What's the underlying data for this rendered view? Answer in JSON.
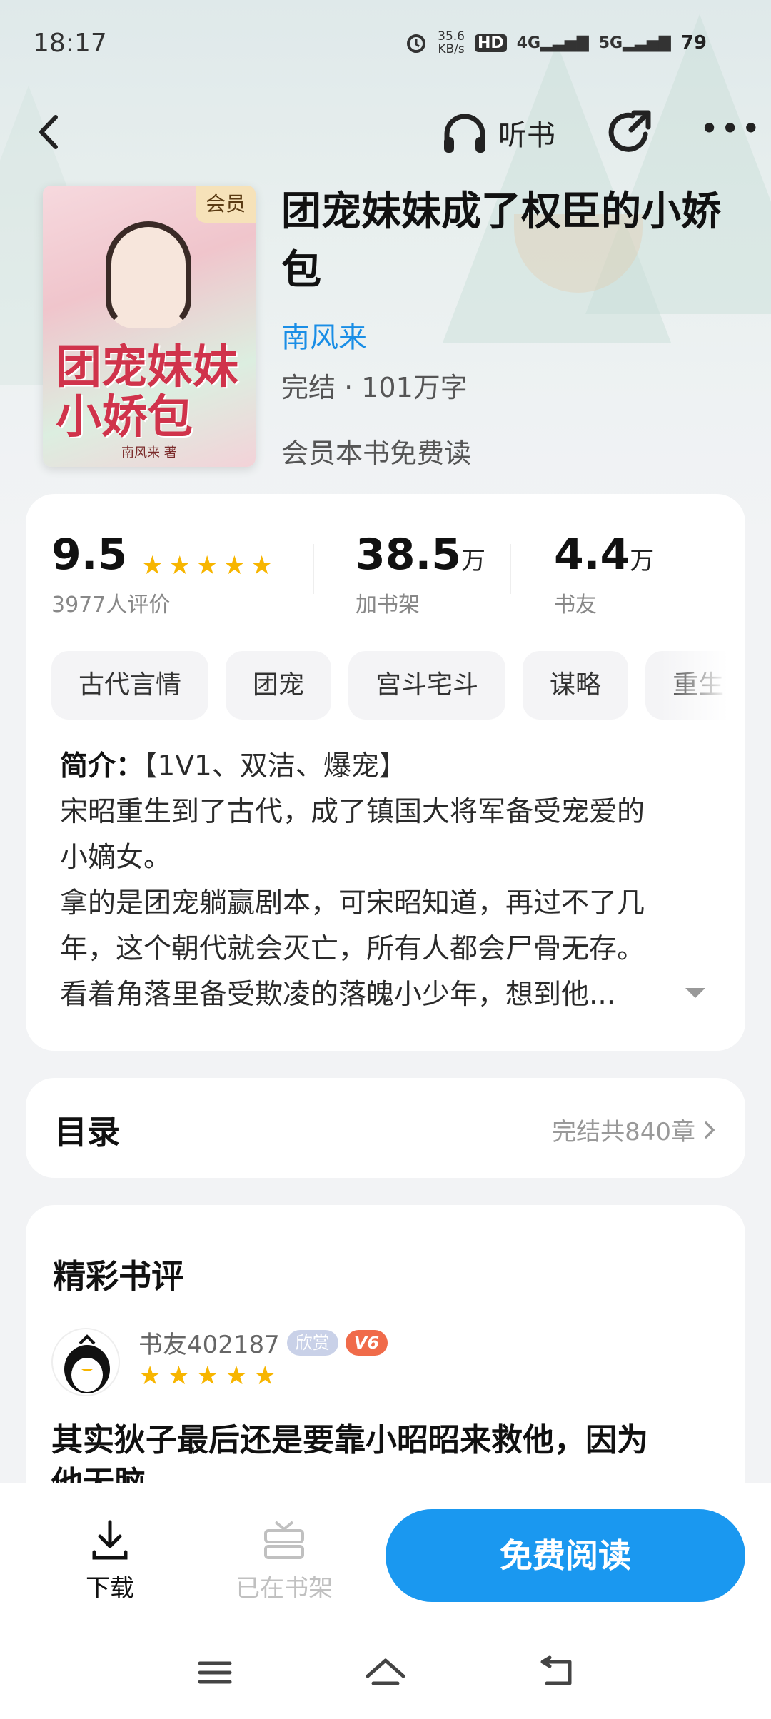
{
  "status_bar": {
    "time": "18:17",
    "net_speed": "35.6",
    "net_unit": "KB/s",
    "hd": "HD",
    "net1": "4G",
    "net2": "5G",
    "battery": "79"
  },
  "header": {
    "listen_label": "听书"
  },
  "book": {
    "cover_badge": "会员",
    "cover_title": "团宠妹妹小娇包",
    "cover_author": "南风来 著",
    "title": "团宠妹妹成了权臣的小娇包",
    "author": "南风来",
    "meta": "完结 · 101万字",
    "vip_note": "会员本书免费读"
  },
  "stats": {
    "rating": "9.5",
    "rating_label": "3977人评价",
    "shelf_count": "38.5",
    "shelf_unit": "万",
    "shelf_label": "加书架",
    "friends_count": "4.4",
    "friends_unit": "万",
    "friends_label": "书友",
    "rating_stars": 5
  },
  "tags": [
    "古代言情",
    "团宠",
    "宫斗宅斗",
    "谋略",
    "重生"
  ],
  "intro": {
    "label": "简介：",
    "lines": [
      "【1V1、双洁、爆宠】",
      "宋昭重生到了古代，成了镇国大将军备受宠爱的",
      "小嫡女。",
      "拿的是团宠躺赢剧本，可宋昭知道，再过不了几",
      "年，这个朝代就会灭亡，所有人都会尸骨无存。",
      "看着角落里备受欺凌的落魄小少年，想到他..."
    ]
  },
  "toc": {
    "title": "目录",
    "summary": "完结共840章"
  },
  "reviews": {
    "title": "精彩书评",
    "reviewer_name": "书友402187",
    "badge_appreciate": "欣赏",
    "badge_level": "V6",
    "stars": 5,
    "text": "其实狄子最后还是要靠小昭昭来救他，因为",
    "text_cut": "他无脑"
  },
  "actions": {
    "download": "下载",
    "on_shelf": "已在书架",
    "read": "免费阅读"
  },
  "colors": {
    "accent": "#1a98f0",
    "author": "#1a8ee6",
    "star": "#f7b500"
  }
}
